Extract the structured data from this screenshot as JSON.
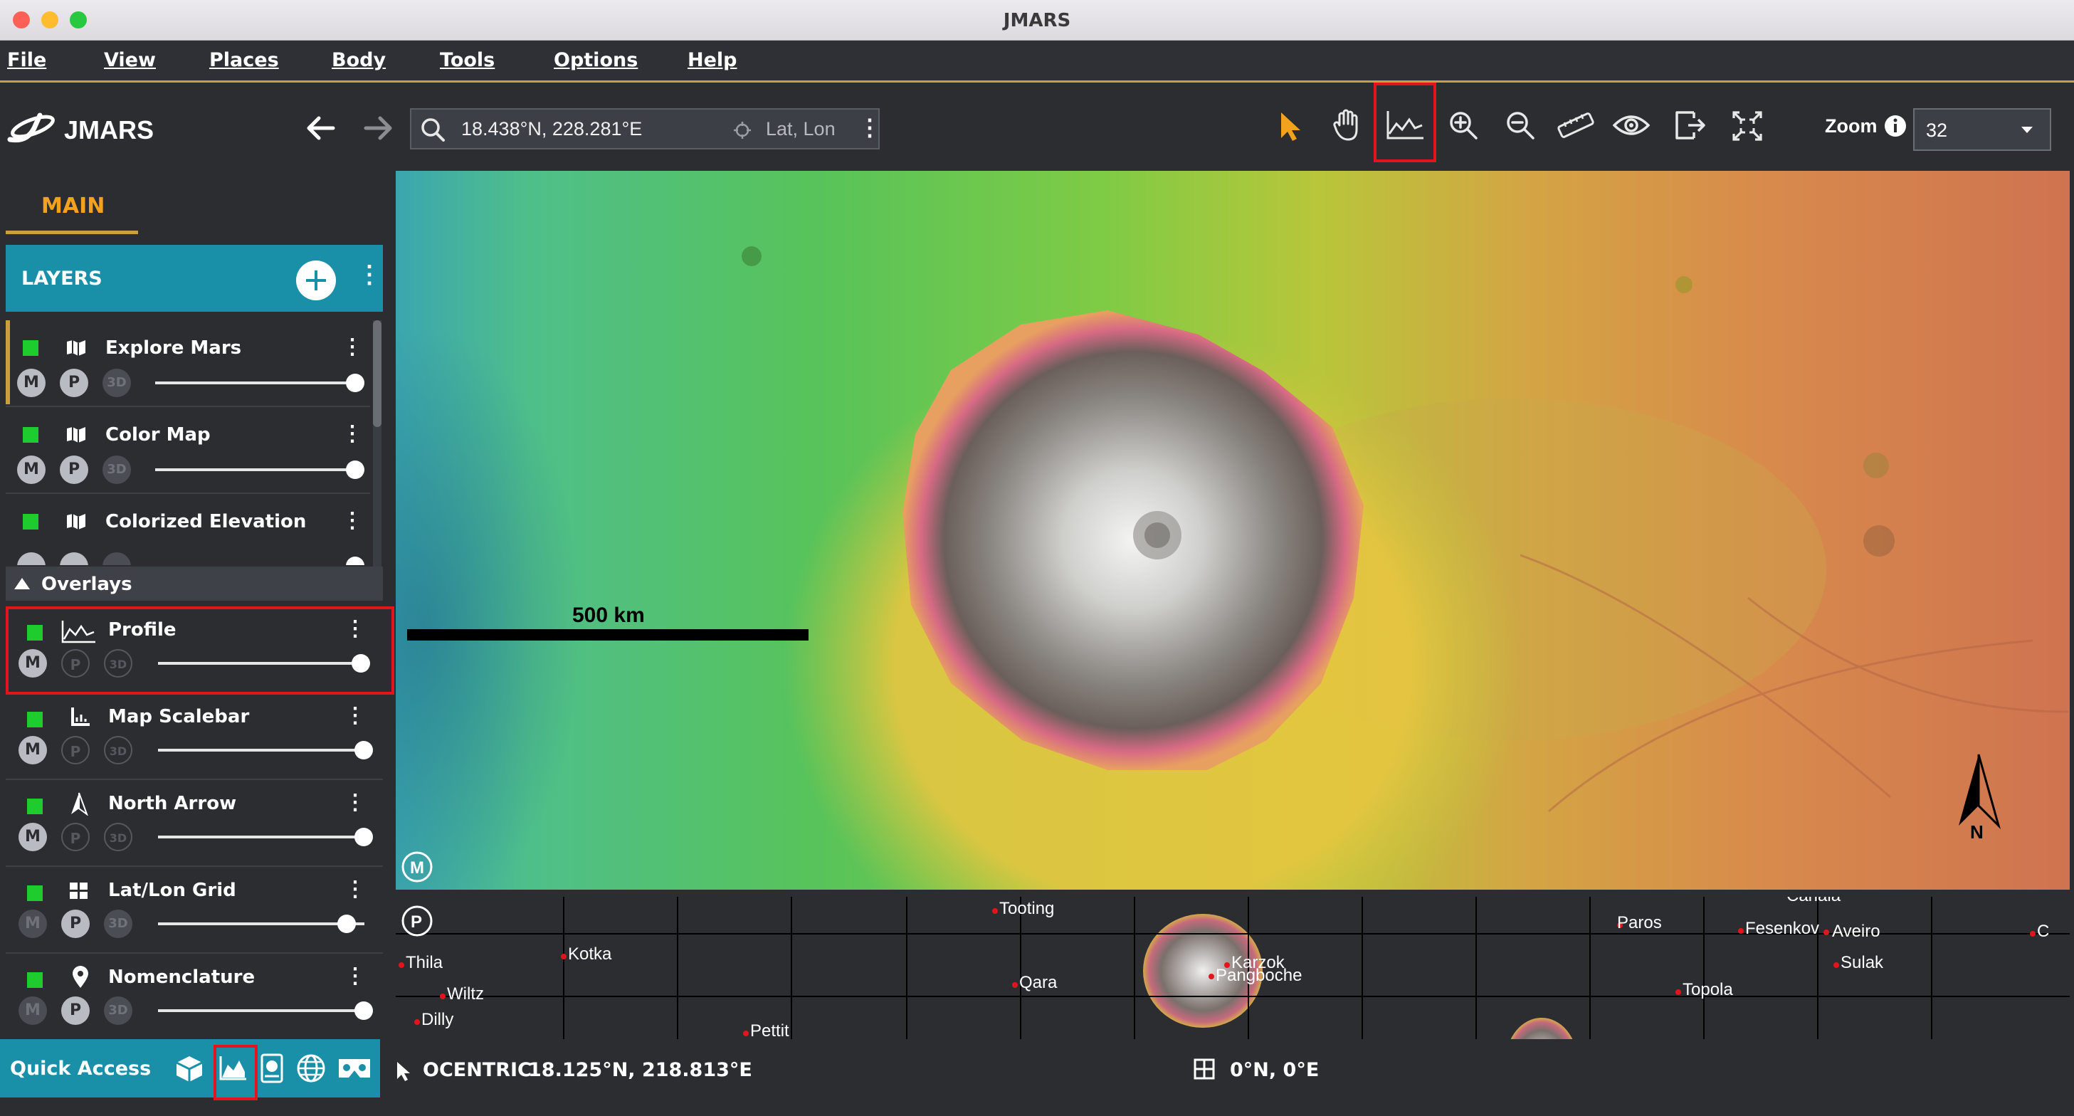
{
  "window": {
    "title": "JMARS"
  },
  "menu": [
    "File",
    "View",
    "Places",
    "Body",
    "Tools",
    "Options",
    "Help"
  ],
  "header": {
    "app_name": "JMARS",
    "search_value": "18.438°N, 228.281°E",
    "coord_mode": "Lat, Lon",
    "zoom_label": "Zoom",
    "zoom_value": "32"
  },
  "tabs": {
    "main": "MAIN"
  },
  "layers_panel": {
    "title": "LAYERS",
    "layers": [
      {
        "name": "Explore Mars"
      },
      {
        "name": "Color Map"
      },
      {
        "name": "Colorized Elevation"
      }
    ],
    "overlays_title": "Overlays",
    "overlays": [
      {
        "name": "Profile"
      },
      {
        "name": "Map Scalebar"
      },
      {
        "name": "North Arrow"
      },
      {
        "name": "Lat/Lon Grid"
      },
      {
        "name": "Nomenclature"
      }
    ],
    "button_labels": {
      "m": "M",
      "p": "P",
      "three_d": "3D"
    }
  },
  "quick_access": {
    "label": "Quick Access"
  },
  "map": {
    "scalebar_label": "500 km",
    "north_label": "N",
    "main_badge": "M",
    "panner_badge": "P"
  },
  "panner_labels": [
    {
      "name": "Tooting"
    },
    {
      "name": "Paros"
    },
    {
      "name": "Canala"
    },
    {
      "name": "Fesenkov"
    },
    {
      "name": "Aveiro"
    },
    {
      "name": "Thila"
    },
    {
      "name": "Kotka"
    },
    {
      "name": "Karzok"
    },
    {
      "name": "Pangboche"
    },
    {
      "name": "Sulak"
    },
    {
      "name": "Wiltz"
    },
    {
      "name": "Qara"
    },
    {
      "name": "Topola"
    },
    {
      "name": "Dilly"
    },
    {
      "name": "Pettit"
    },
    {
      "name": "C"
    }
  ],
  "status": {
    "coord_label": "OCENTRIC",
    "coord_value": "18.125°N, 218.813°E",
    "center_value": "0°N, 0°E"
  },
  "colors": {
    "accent_gold": "#c9a13a",
    "layers_header": "#1a90a8",
    "highlight_red": "#e3151c",
    "layer_check": "#1fcc2e"
  }
}
